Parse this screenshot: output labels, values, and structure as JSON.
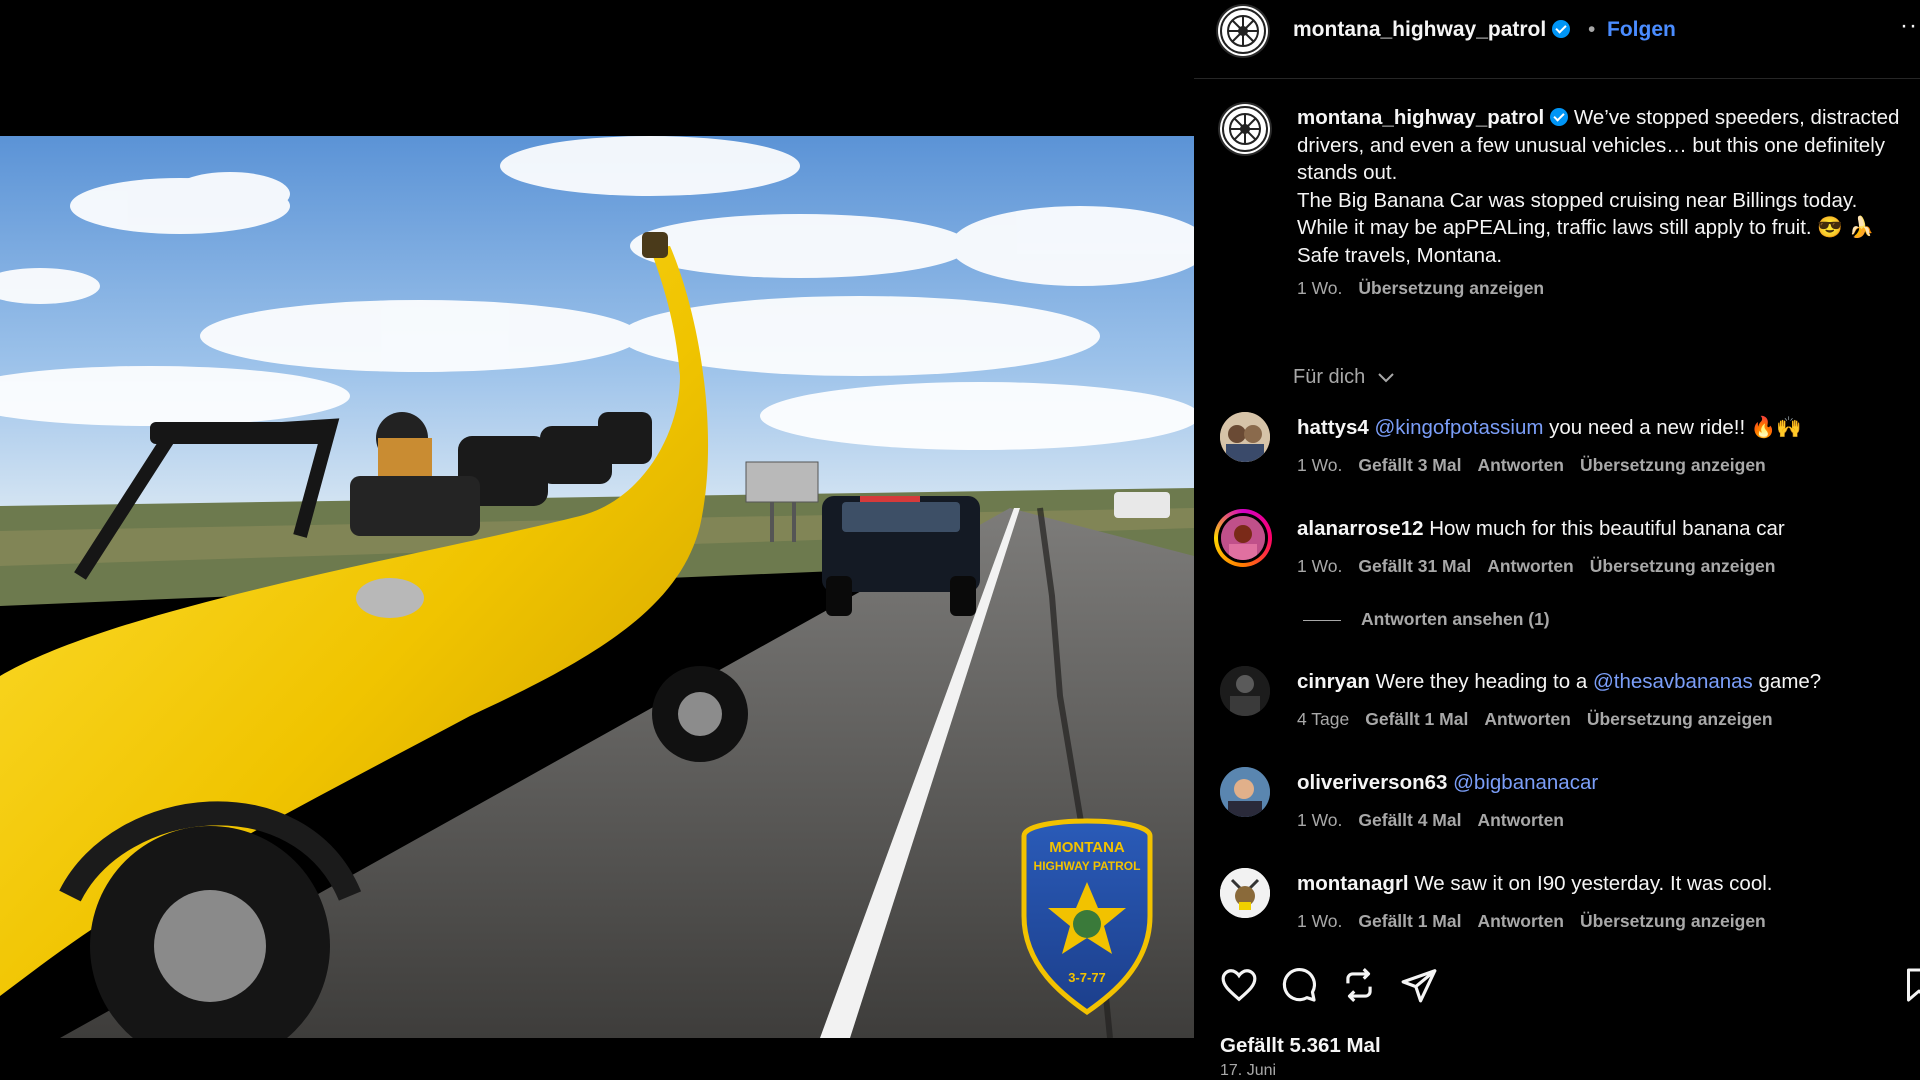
{
  "post": {
    "username": "montana_highway_patrol",
    "separator": "•",
    "follow_label": "Folgen",
    "more_label": "···",
    "photo_badge": {
      "line1": "MONTANA",
      "line2": "HIGHWAY PATROL",
      "bottom": "3-7-77"
    }
  },
  "caption": {
    "username": "montana_highway_patrol",
    "line1": "We’ve stopped speeders, distracted drivers, and even a few unusual vehicles… but this one definitely stands out.",
    "line2": "The Big Banana Car was stopped cruising near Billings today. While it may be apPEALing, traffic laws still apply to fruit. 😎 🍌",
    "line3": "Safe travels, Montana.",
    "age": "1 Wo.",
    "translate": "Übersetzung anzeigen"
  },
  "sort_label": "Für dich",
  "comments": [
    {
      "user": "hattys4",
      "mention": "@kingofpotassium",
      "text": "you need a new ride!! 🔥🙌",
      "age": "1 Wo.",
      "likes": "Gefällt 3 Mal",
      "reply": "Antworten",
      "translate": "Übersetzung anzeigen"
    },
    {
      "user": "alanarrose12",
      "text": "How much for this beautiful banana car",
      "age": "1 Wo.",
      "likes": "Gefällt 31 Mal",
      "reply": "Antworten",
      "translate": "Übersetzung anzeigen"
    },
    {
      "user": "cinryan",
      "text_before": "Were they heading to a",
      "mention": "@thesavbananas",
      "text_after": "game?",
      "age": "4 Tage",
      "likes": "Gefällt 1 Mal",
      "reply": "Antworten",
      "translate": "Übersetzung anzeigen"
    },
    {
      "user": "oliveriverson63",
      "mention": "@bigbananacar",
      "age": "1 Wo.",
      "likes": "Gefällt 4 Mal",
      "reply": "Antworten"
    },
    {
      "user": "montanagrl",
      "text": "We saw it on I90 yesterday. It was cool.",
      "age": "1 Wo.",
      "likes": "Gefällt 1 Mal",
      "reply": "Antworten",
      "translate": "Übersetzung anzeigen"
    }
  ],
  "view_replies": "Antworten ansehen (1)",
  "actions": {
    "like_icon": "heart-icon",
    "comment_icon": "comment-icon",
    "repost_icon": "repost-icon",
    "share_icon": "send-icon",
    "save_icon": "bookmark-icon"
  },
  "likes_total": "Gefällt 5.361 Mal",
  "post_date": "17. Juni",
  "colors": {
    "background": "#000000",
    "text": "#f5f5f5",
    "muted": "#a8a8a8",
    "link": "#4a8cff",
    "mention": "#7b9ef8",
    "verified": "#0095f6",
    "banana": "#f2cc00"
  }
}
